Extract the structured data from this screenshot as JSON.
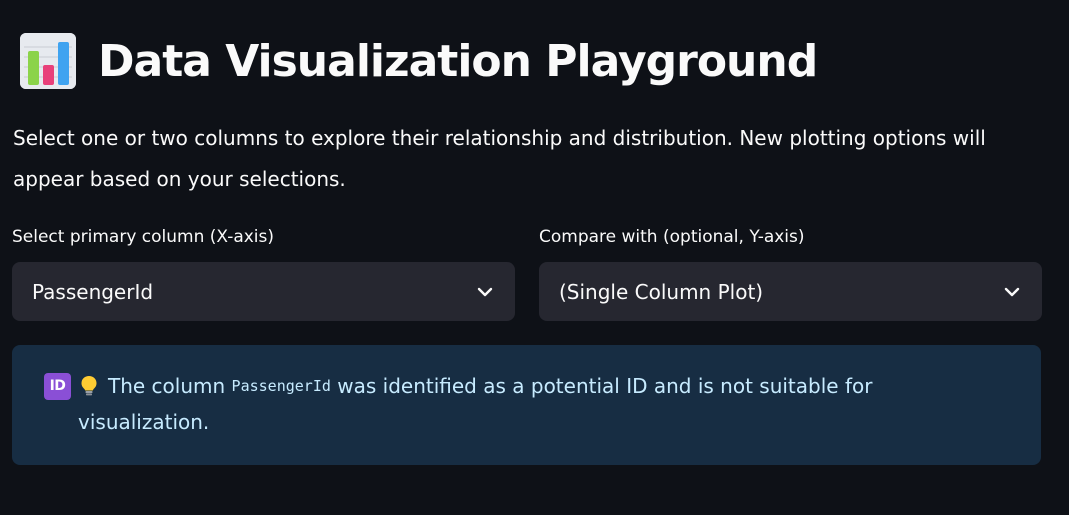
{
  "header": {
    "icon": "bar-chart-emoji-icon",
    "title": "Data Visualization Playground"
  },
  "intro": {
    "text": "Select one or two columns to explore their relationship and distribution. New plotting options will appear based on your selections."
  },
  "primary_select": {
    "label": "Select primary column (X-axis)",
    "value": "PassengerId",
    "icon": "chevron-down-icon"
  },
  "compare_select": {
    "label": "Compare with (optional, Y-axis)",
    "value": "(Single Column Plot)",
    "icon": "chevron-down-icon"
  },
  "info": {
    "badge": "ID",
    "bulb_icon": "lightbulb-icon",
    "text_before": "The column",
    "code": "PassengerId",
    "text_after": "was identified as a potential ID and is not suitable for",
    "text_line2": "visualization."
  },
  "colors": {
    "background": "#0e1117",
    "select_background": "#262730",
    "info_background": "#172d43",
    "info_text": "#c7ebff",
    "id_badge": "#8a4fd6"
  }
}
